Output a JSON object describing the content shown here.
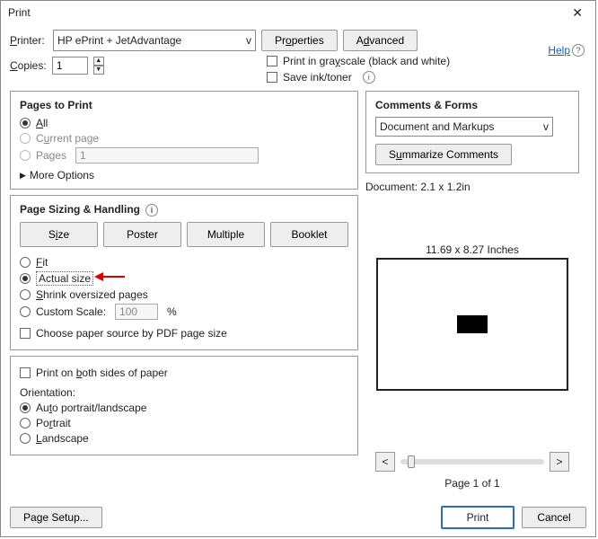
{
  "title": "Print",
  "help_label": "Help",
  "printer_label": "Printer:",
  "printer_value": "HP ePrint + JetAdvantage",
  "properties_label": "Properties",
  "advanced_label": "Advanced",
  "copies_label": "Copies:",
  "copies_value": "1",
  "grayscale_label": "Print in grayscale (black and white)",
  "saveink_label": "Save ink/toner",
  "pages_to_print_title": "Pages to Print",
  "radio_all": "All",
  "radio_current": "Current page",
  "radio_pages": "Pages",
  "pages_field_value": "1",
  "more_options": "More Options",
  "sizing_title": "Page Sizing & Handling",
  "btn_size": "Size",
  "btn_poster": "Poster",
  "btn_multiple": "Multiple",
  "btn_booklet": "Booklet",
  "radio_fit": "Fit",
  "radio_actual": "Actual size",
  "radio_shrink": "Shrink oversized pages",
  "radio_custom": "Custom Scale:",
  "custom_scale_value": "100",
  "percent": "%",
  "choose_paper": "Choose paper source by PDF page size",
  "print_both": "Print on both sides of paper",
  "orientation_title": "Orientation:",
  "radio_auto_orient": "Auto portrait/landscape",
  "radio_portrait": "Portrait",
  "radio_landscape": "Landscape",
  "comments_title": "Comments & Forms",
  "comments_combo": "Document and Markups",
  "summarize_label": "Summarize Comments",
  "doc_dim": "Document: 2.1 x 1.2in",
  "preview_size": "11.69 x 8.27 Inches",
  "page_of": "Page 1 of 1",
  "page_setup_label": "Page Setup...",
  "print_label": "Print",
  "cancel_label": "Cancel",
  "nav_prev": "<",
  "nav_next": ">",
  "chev_down": "v"
}
